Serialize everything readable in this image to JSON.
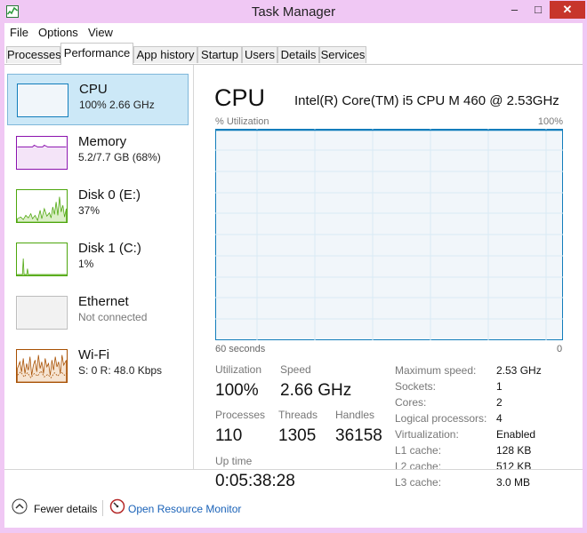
{
  "window": {
    "title": "Task Manager"
  },
  "titlebar": {
    "min_glyph": "–",
    "max_glyph": "□",
    "close_glyph": "✕"
  },
  "menu": [
    "File",
    "Options",
    "View"
  ],
  "tabs": [
    {
      "label": "Processes",
      "active": false
    },
    {
      "label": "Performance",
      "active": true
    },
    {
      "label": "App history",
      "active": false
    },
    {
      "label": "Startup",
      "active": false
    },
    {
      "label": "Users",
      "active": false
    },
    {
      "label": "Details",
      "active": false
    },
    {
      "label": "Services",
      "active": false
    }
  ],
  "sidebar": {
    "items": [
      {
        "title": "CPU",
        "subtitle": "100%  2.66 GHz",
        "selected": true,
        "color": "#117dbb"
      },
      {
        "title": "Memory",
        "subtitle": "5.2/7.7 GB (68%)",
        "selected": false,
        "color": "#8b12ae"
      },
      {
        "title": "Disk 0 (E:)",
        "subtitle": "37%",
        "selected": false,
        "color": "#4da60c"
      },
      {
        "title": "Disk 1 (C:)",
        "subtitle": "1%",
        "selected": false,
        "color": "#4da60c"
      },
      {
        "title": "Ethernet",
        "subtitle": "Not connected",
        "selected": false,
        "color": "#a0a0a0"
      },
      {
        "title": "Wi-Fi",
        "subtitle": "S: 0 R: 48.0 Kbps",
        "selected": false,
        "color": "#a74f01"
      }
    ]
  },
  "main": {
    "title": "CPU",
    "cpu_name": "Intel(R) Core(TM) i5 CPU M 460 @ 2.53GHz",
    "graph": {
      "y_label": "% Utilization",
      "y_max_label": "100%",
      "x_left_label": "60 seconds",
      "x_right_label": "0",
      "utilization": 1.0,
      "fill_color": "#f1f6fa",
      "border_color": "#117dbb",
      "grid_color": "#d9eaf4"
    },
    "stats": {
      "utilization_label": "Utilization",
      "utilization_value": "100%",
      "speed_label": "Speed",
      "speed_value": "2.66 GHz",
      "processes_label": "Processes",
      "processes_value": "110",
      "threads_label": "Threads",
      "threads_value": "1305",
      "handles_label": "Handles",
      "handles_value": "36158",
      "uptime_label": "Up time",
      "uptime_value": "0:05:38:28"
    },
    "specs": [
      {
        "label": "Maximum speed:",
        "value": "2.53 GHz"
      },
      {
        "label": "Sockets:",
        "value": "1"
      },
      {
        "label": "Cores:",
        "value": "2"
      },
      {
        "label": "Logical processors:",
        "value": "4"
      },
      {
        "label": "Virtualization:",
        "value": "Enabled"
      },
      {
        "label": "L1 cache:",
        "value": "128 KB"
      },
      {
        "label": "L2 cache:",
        "value": "512 KB"
      },
      {
        "label": "L3 cache:",
        "value": "3.0 MB"
      }
    ]
  },
  "footer": {
    "fewer_details_label": "Fewer details",
    "resource_monitor_label": "Open Resource Monitor"
  }
}
